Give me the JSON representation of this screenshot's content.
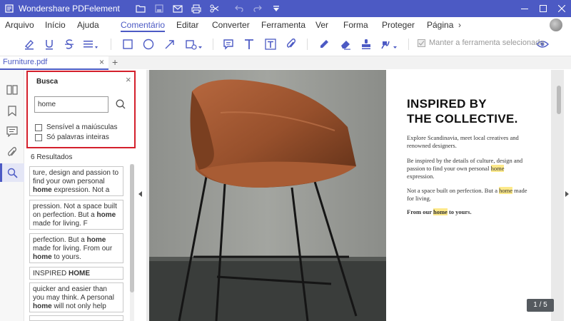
{
  "titlebar": {
    "app_title": "Wondershare PDFelement",
    "icons": [
      "folder-icon",
      "save-icon",
      "mail-icon",
      "print-icon",
      "scissors-icon",
      "undo-icon",
      "redo-icon",
      "dropdown-icon"
    ],
    "window_controls": [
      "minimize",
      "maximize",
      "close"
    ]
  },
  "menu": {
    "items": [
      "Arquivo",
      "Início",
      "Ajuda",
      "Comentário",
      "Editar",
      "Converter",
      "Ferramenta",
      "Ver",
      "Forma",
      "Proteger",
      "Página"
    ],
    "active": "Comentário",
    "more": "›"
  },
  "toolbar": {
    "icons": [
      "highlight-icon",
      "underline-icon",
      "strikethrough-icon",
      "lines-dropdown-icon",
      "rectangle-icon",
      "circle-icon",
      "arrow-icon",
      "shape-dropdown-icon",
      "note-icon",
      "text-icon",
      "textbox-icon",
      "attach-icon",
      "pencil-icon",
      "eraser-icon",
      "stamp-icon",
      "sign-dropdown-icon",
      "eye-icon"
    ],
    "keep_tool_label": "Manter a ferramenta selecionada",
    "keep_tool_checked": true
  },
  "tabs": {
    "doc_tab": "Furniture.pdf",
    "close": "×",
    "add": "+"
  },
  "search": {
    "title": "Busca",
    "close": "×",
    "query": "home",
    "option_case": "Sensível a maiúsculas",
    "option_words": "Só palavras inteiras",
    "results_count": "6 Resultados",
    "results": [
      {
        "pre": "ture, design and passion to find your own personal ",
        "match": "home",
        "post": " expression. Not a"
      },
      {
        "pre": "pression. Not a space built on perfection. But a ",
        "match": "home",
        "post": " made for living. F"
      },
      {
        "pre": "perfection. But a ",
        "match": "home",
        "post": " made for living. From our ",
        "match2": "home",
        "post2": " to yours."
      },
      {
        "pre": "INSPIRED ",
        "match": "HOME",
        "post": ""
      },
      {
        "pre": "quicker and easier than you may think. A personal ",
        "match": "home",
        "post": " will not only help"
      }
    ]
  },
  "document": {
    "heading_line1": "INSPIRED BY",
    "heading_line2": "THE COLLECTIVE.",
    "p1": "Explore Scandinavia, meet local creatives and renowned designers.",
    "p2_pre": "Be inspired by the details of culture, design and passion to find your own personal ",
    "p2_hl": "home",
    "p2_post": " expression.",
    "p3_pre": "Not a space built on perfection. But a ",
    "p3_hl": "home",
    "p3_post": " made for living.",
    "p4_pre": "From our ",
    "p4_hl": "home",
    "p4_post": " to yours.",
    "page_indicator": "1 / 5"
  },
  "colors": {
    "accent": "#4c5ac4",
    "highlight": "#fde98a",
    "search_border": "#d4202c"
  }
}
